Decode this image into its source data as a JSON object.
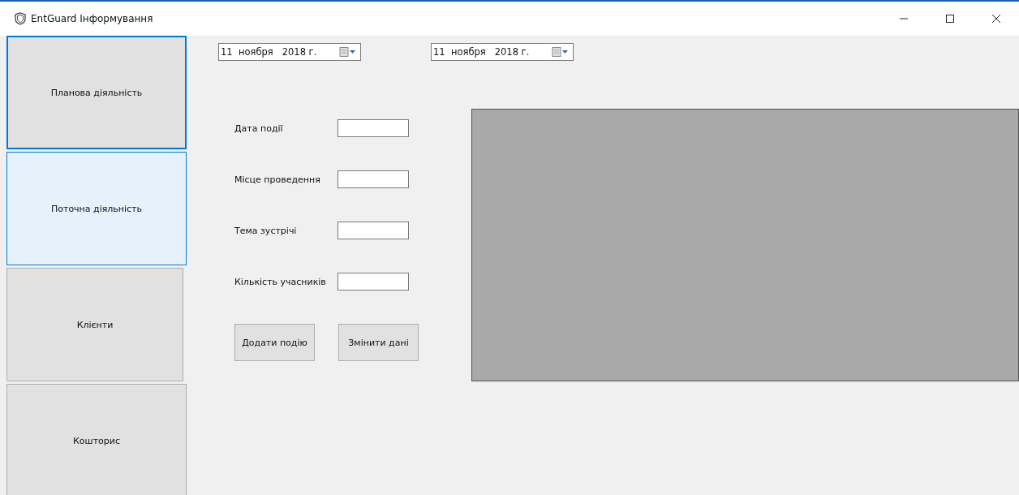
{
  "window": {
    "title": "EntGuard Інформування"
  },
  "sidebar": {
    "items": [
      {
        "label": "Планова діяльність",
        "selected": true,
        "highlighted": false
      },
      {
        "label": "Поточна діяльність",
        "selected": false,
        "highlighted": true
      },
      {
        "label": "Клієнти",
        "selected": false,
        "highlighted": false
      },
      {
        "label": "Кошторис",
        "selected": false,
        "highlighted": false
      }
    ]
  },
  "date_pickers": [
    {
      "value": "11  ноября   2018 г."
    },
    {
      "value": "11  ноября   2018 г."
    }
  ],
  "form": {
    "fields": [
      {
        "label": "Дата події"
      },
      {
        "label": "Місце проведення"
      },
      {
        "label": "Тема зустрічі"
      },
      {
        "label": "Кількість учасників"
      }
    ],
    "buttons": [
      "Додати подію",
      "Змінити дані"
    ]
  }
}
